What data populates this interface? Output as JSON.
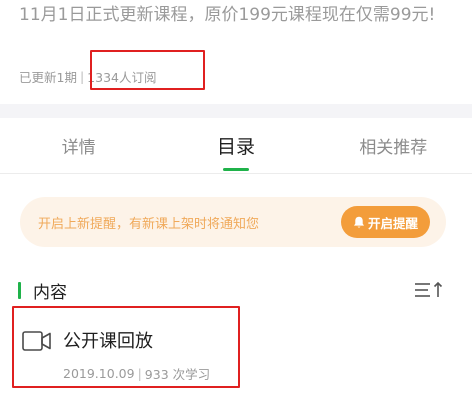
{
  "course": {
    "description": "11月1日正式更新课程，原价199元课程现在仅需99元!",
    "updated": "已更新1期",
    "subscribers": "1334人订阅"
  },
  "tabs": [
    {
      "label": "详情",
      "active": false
    },
    {
      "label": "目录",
      "active": true
    },
    {
      "label": "相关推荐",
      "active": false
    }
  ],
  "reminder": {
    "text": "开启上新提醒，有新课上架时将通知您",
    "button_label": "开启提醒"
  },
  "content_section": {
    "title": "内容"
  },
  "lesson": {
    "title": "公开课回放",
    "date": "2019.10.09",
    "views": "933 次学习"
  },
  "colors": {
    "accent_green": "#1fb24a",
    "reminder_orange": "#f39d3b",
    "highlight_red": "#e02020"
  }
}
